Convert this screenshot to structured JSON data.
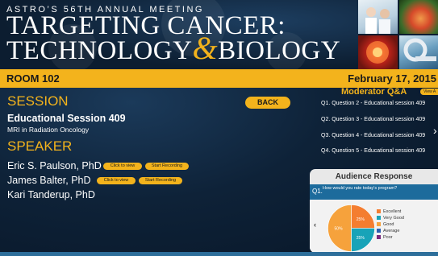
{
  "banner": {
    "meeting": "ASTRO’S 56TH ANNUAL MEETING",
    "title_line1": "TARGETING CANCER:",
    "title_line2a": "TECHNOLOGY",
    "amp": "&",
    "title_line2b": "BIOLOGY"
  },
  "room_bar": {
    "room": "ROOM 102",
    "date": "February 17, 2015"
  },
  "session": {
    "heading": "SESSION",
    "title": "Educational Session 409",
    "subtitle": "MRI in Radiation Oncology",
    "back_label": "BACK"
  },
  "speakers": {
    "heading": "SPEAKER",
    "list": [
      {
        "name": "Eric S. Paulson, PhD",
        "view_label": "Click to view",
        "record_label": "Start Recording"
      },
      {
        "name": "James  Balter, PhD",
        "view_label": "Click to view",
        "record_label": "Start Recording"
      },
      {
        "name": "Kari  Tanderup, PhD"
      }
    ]
  },
  "moderator_qa": {
    "title": "Moderator Q&A",
    "view_all": "View A",
    "questions": [
      "Q1. Question 2 - Educational session 409",
      "Q2. Question 3 - Educational session 409",
      "Q3. Question 4 - Educational session 409",
      "Q4. Question 5 - Educational session 409"
    ],
    "more_icon": "chevron-right-icon"
  },
  "audience_response": {
    "title": "Audience Response",
    "q_number": "Q1.",
    "question": "How would you rate today's program?",
    "prev_icon": "chevron-left-icon",
    "prev_glyph": "‹",
    "chart_data": {
      "type": "pie",
      "slices": [
        {
          "label": "Excellent",
          "value": 25,
          "color": "#f47d30"
        },
        {
          "label": "Very Good",
          "value": 25,
          "color": "#18a3b8"
        },
        {
          "label": "Good",
          "value": 50,
          "color": "#f6a23c"
        },
        {
          "label": "Average",
          "value": 0,
          "color": "#2c5fb0"
        },
        {
          "label": "Poor",
          "value": 0,
          "color": "#7a2a7d"
        }
      ],
      "pct_labels": [
        "25%",
        "25%",
        "50%"
      ]
    }
  },
  "colors": {
    "accent": "#f3b31c",
    "background": "#0e2238",
    "question_bar": "#1d6b9c"
  }
}
